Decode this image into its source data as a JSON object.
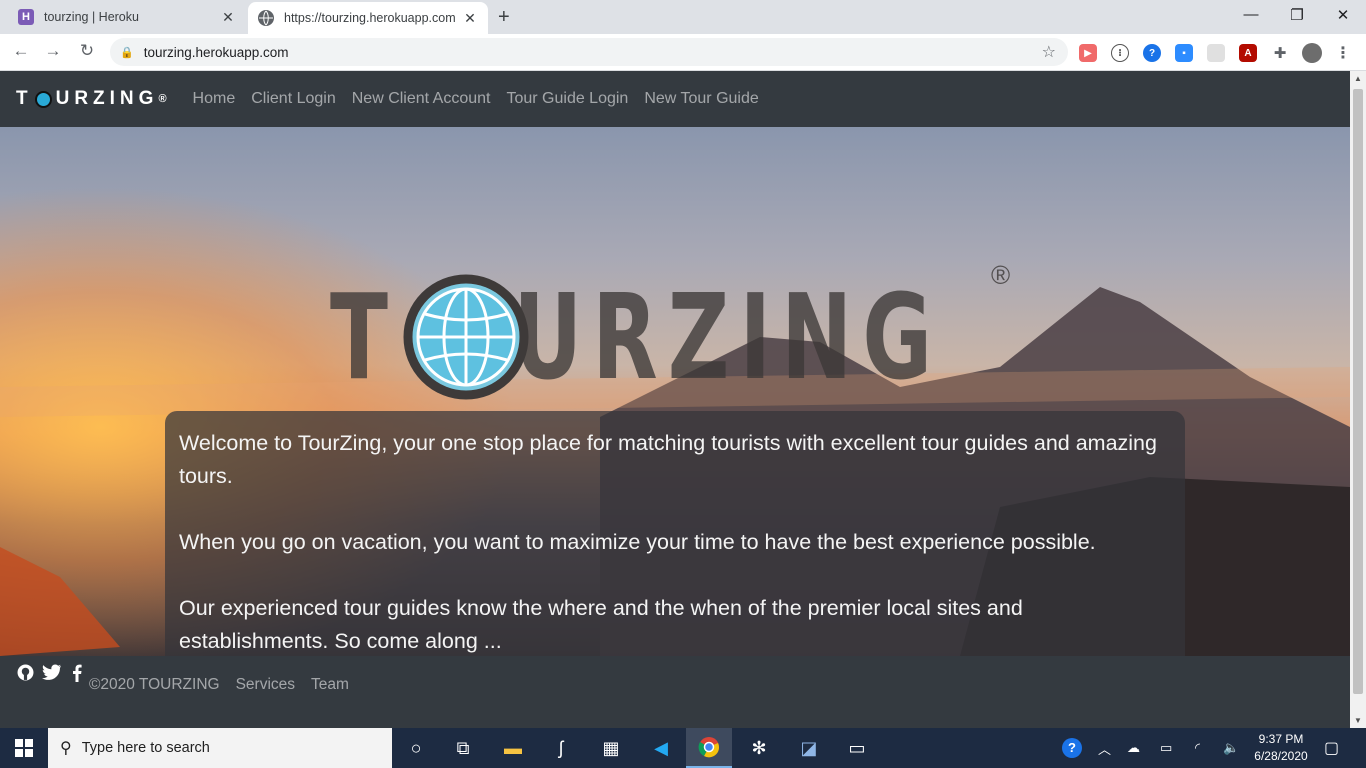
{
  "browser": {
    "tabs": [
      {
        "title": "tourzing | Heroku",
        "state": "inactive",
        "favicon": "heroku-icon"
      },
      {
        "title": "https://tourzing.herokuapp.com",
        "state": "active",
        "favicon": "globe-icon"
      }
    ],
    "url": "tourzing.herokuapp.com"
  },
  "site": {
    "brand": "TOURZING",
    "brand_reg": "®",
    "nav": [
      "Home",
      "Client Login",
      "New Client Account",
      "Tour Guide Login",
      "New Tour Guide"
    ],
    "hero": {
      "logo_text": "TOURZING",
      "logo_reg": "®",
      "paragraphs": [
        "Welcome to TourZing, your one stop place for matching tourists with excellent tour guides and amazing tours.",
        "When you go on vacation, you want to maximize your time to have the best experience possible.",
        "Our experienced tour guides know the where and the when of the premier local sites and establishments. So come along ..."
      ]
    },
    "footer": {
      "copyright": "©2020 TOURZING",
      "links": [
        "Services",
        "Team"
      ],
      "social": [
        "github-icon",
        "twitter-icon",
        "facebook-icon"
      ]
    }
  },
  "taskbar": {
    "search_placeholder": "Type here to search",
    "time": "9:37 PM",
    "date": "6/28/2020"
  },
  "colors": {
    "navbar": "#343a40",
    "globe": "#29a9d6",
    "taskbar": "#1d2b42"
  }
}
